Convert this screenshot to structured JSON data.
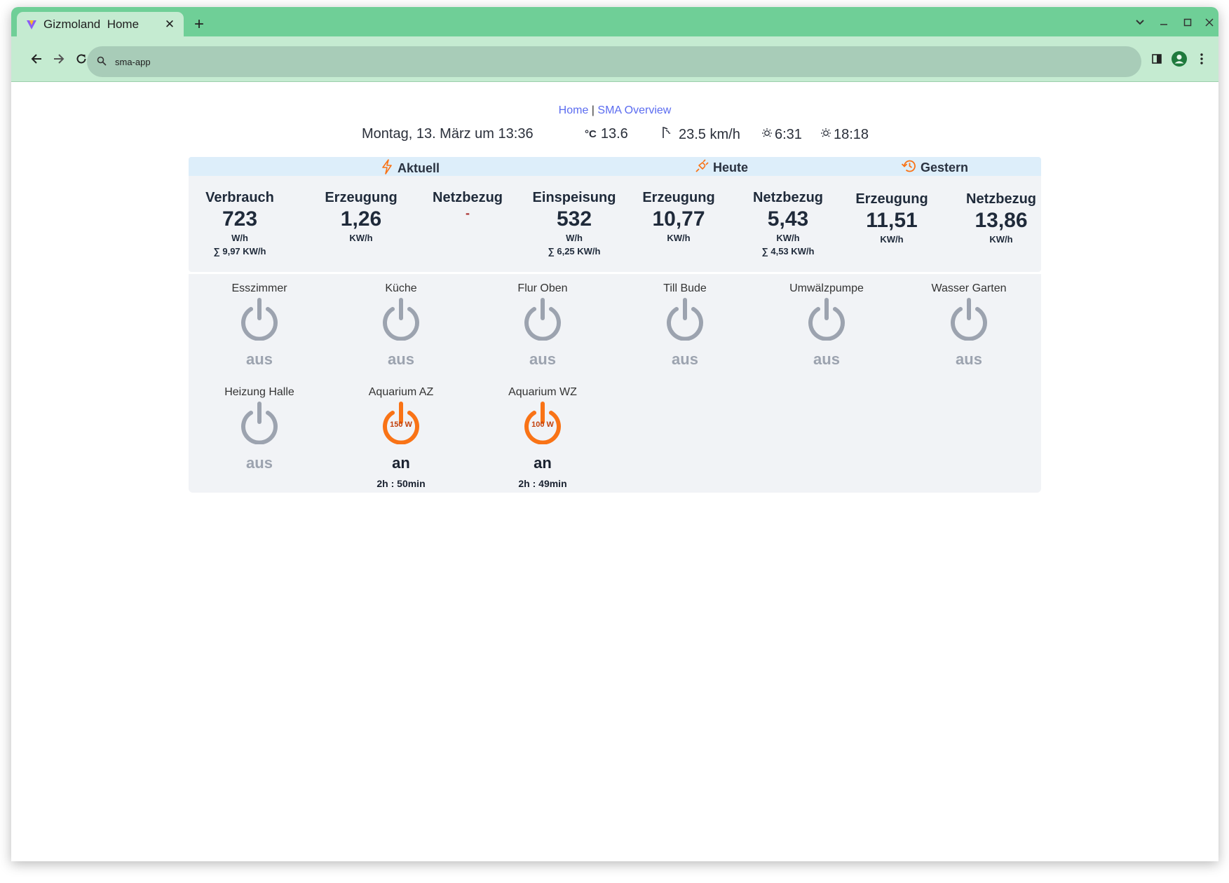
{
  "browser": {
    "tab_title": "Gizmoland  Home",
    "url": "sma-app",
    "accent": "#6fcf97"
  },
  "nav": {
    "home": "Home",
    "separator": "|",
    "overview": "SMA Overview"
  },
  "info": {
    "date": "Montag, 13. März um 13:36",
    "temp_unit": "°C",
    "temp": "13.6",
    "wind": "23.5 km/h",
    "sunrise": "6:31",
    "sunset": "18:18"
  },
  "headers": {
    "current": "Aktuell",
    "today": "Heute",
    "yesterday": "Gestern"
  },
  "stats": [
    {
      "title": "Verbrauch",
      "value": "723",
      "unit": "W/h",
      "sum": "∑ 9,97 KW/h"
    },
    {
      "title": "Erzeugung",
      "value": "1,26",
      "unit": "KW/h",
      "sum": ""
    },
    {
      "title": "Netzbezug",
      "value": "-",
      "unit": "",
      "sum": ""
    },
    {
      "title": "Einspeisung",
      "value": "532",
      "unit": "W/h",
      "sum": "∑ 6,25 KW/h"
    },
    {
      "title": "Erzeugung",
      "value": "10,77",
      "unit": "KW/h",
      "sum": ""
    },
    {
      "title": "Netzbezug",
      "value": "5,43",
      "unit": "KW/h",
      "sum": "∑ 4,53 KW/h"
    },
    {
      "title": "Erzeugung",
      "value": "11,51",
      "unit": "KW/h",
      "sum": ""
    },
    {
      "title": "Netzbezug",
      "value": "13,86",
      "unit": "KW/h",
      "sum": ""
    }
  ],
  "devices": [
    {
      "name": "Esszimmer",
      "state": "aus",
      "on": false,
      "watt": "",
      "timer": ""
    },
    {
      "name": "Küche",
      "state": "aus",
      "on": false,
      "watt": "",
      "timer": ""
    },
    {
      "name": "Flur Oben",
      "state": "aus",
      "on": false,
      "watt": "",
      "timer": ""
    },
    {
      "name": "Till Bude",
      "state": "aus",
      "on": false,
      "watt": "",
      "timer": ""
    },
    {
      "name": "Umwälzpumpe",
      "state": "aus",
      "on": false,
      "watt": "",
      "timer": ""
    },
    {
      "name": "Wasser Garten",
      "state": "aus",
      "on": false,
      "watt": "",
      "timer": ""
    },
    {
      "name": "Heizung Halle",
      "state": "aus",
      "on": false,
      "watt": "",
      "timer": ""
    },
    {
      "name": "Aquarium AZ",
      "state": "an",
      "on": true,
      "watt": "150 W",
      "timer": "2h : 50min"
    },
    {
      "name": "Aquarium WZ",
      "state": "an",
      "on": true,
      "watt": "100 W",
      "timer": "2h : 49min"
    }
  ],
  "colors": {
    "off": "#9ca3af",
    "on": "#f97316",
    "link": "#5b6cf0"
  }
}
